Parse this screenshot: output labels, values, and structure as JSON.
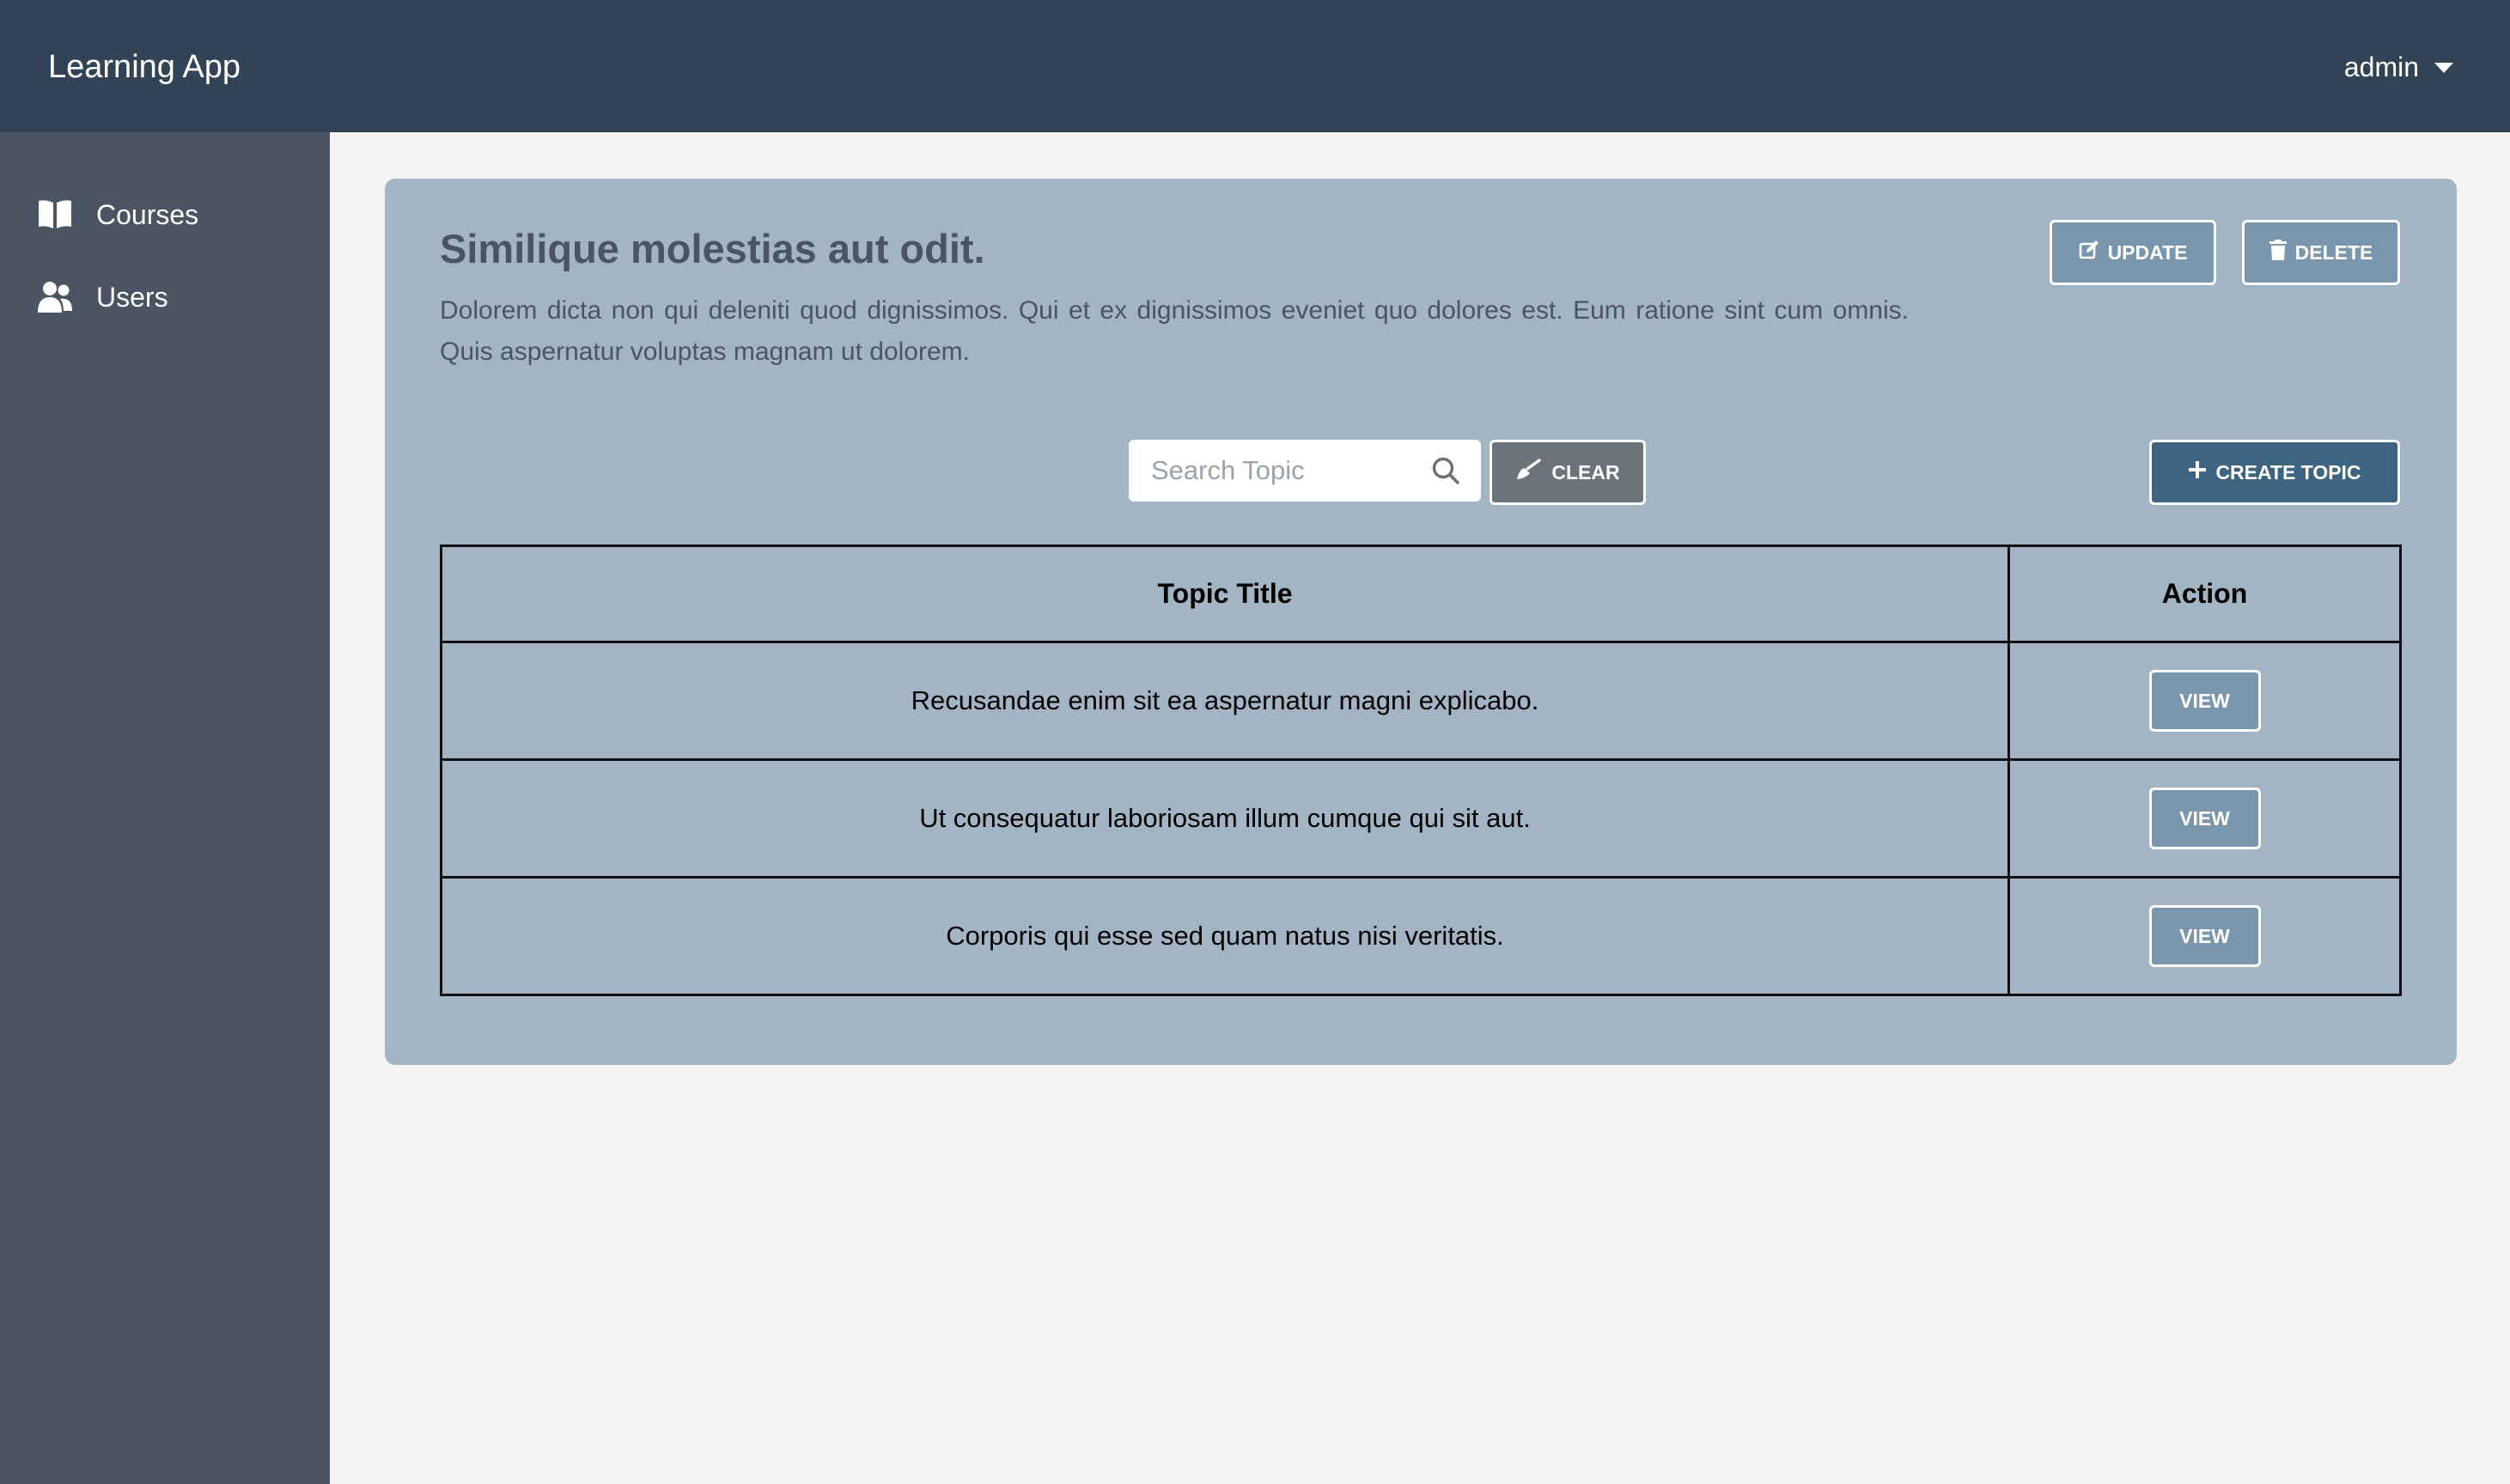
{
  "app": {
    "title": "Learning App"
  },
  "header": {
    "user": "admin"
  },
  "sidebar": {
    "items": [
      {
        "label": "Courses",
        "icon": "book-open-icon"
      },
      {
        "label": "Users",
        "icon": "users-icon"
      }
    ]
  },
  "course": {
    "title": "Similique molestias aut odit.",
    "description": "Dolorem dicta non qui deleniti quod dignissimos. Qui et ex dignissimos eveniet quo dolores est. Eum ratione sint cum omnis. Quis aspernatur voluptas magnam ut dolorem.",
    "update_label": "UPDATE",
    "delete_label": "DELETE"
  },
  "toolbar": {
    "search_placeholder": "Search Topic",
    "search_value": "",
    "clear_label": "CLEAR",
    "create_label": "CREATE TOPIC"
  },
  "table": {
    "headers": [
      "Topic Title",
      "Action"
    ],
    "rows": [
      {
        "title": "Recusandae enim sit ea aspernatur magni explicabo.",
        "action": "VIEW"
      },
      {
        "title": "Ut consequatur laboriosam illum cumque qui sit aut.",
        "action": "VIEW"
      },
      {
        "title": "Corporis qui esse sed quam natus nisi veritatis.",
        "action": "VIEW"
      }
    ]
  },
  "colors": {
    "header_bg": "#334356",
    "sidebar_bg": "#4a5463",
    "card_bg": "#a3b5c4",
    "primary_button": "#3d6582",
    "secondary_button": "#7a96ad",
    "clear_button": "#6d737a",
    "page_bg": "#f2f4f6"
  }
}
